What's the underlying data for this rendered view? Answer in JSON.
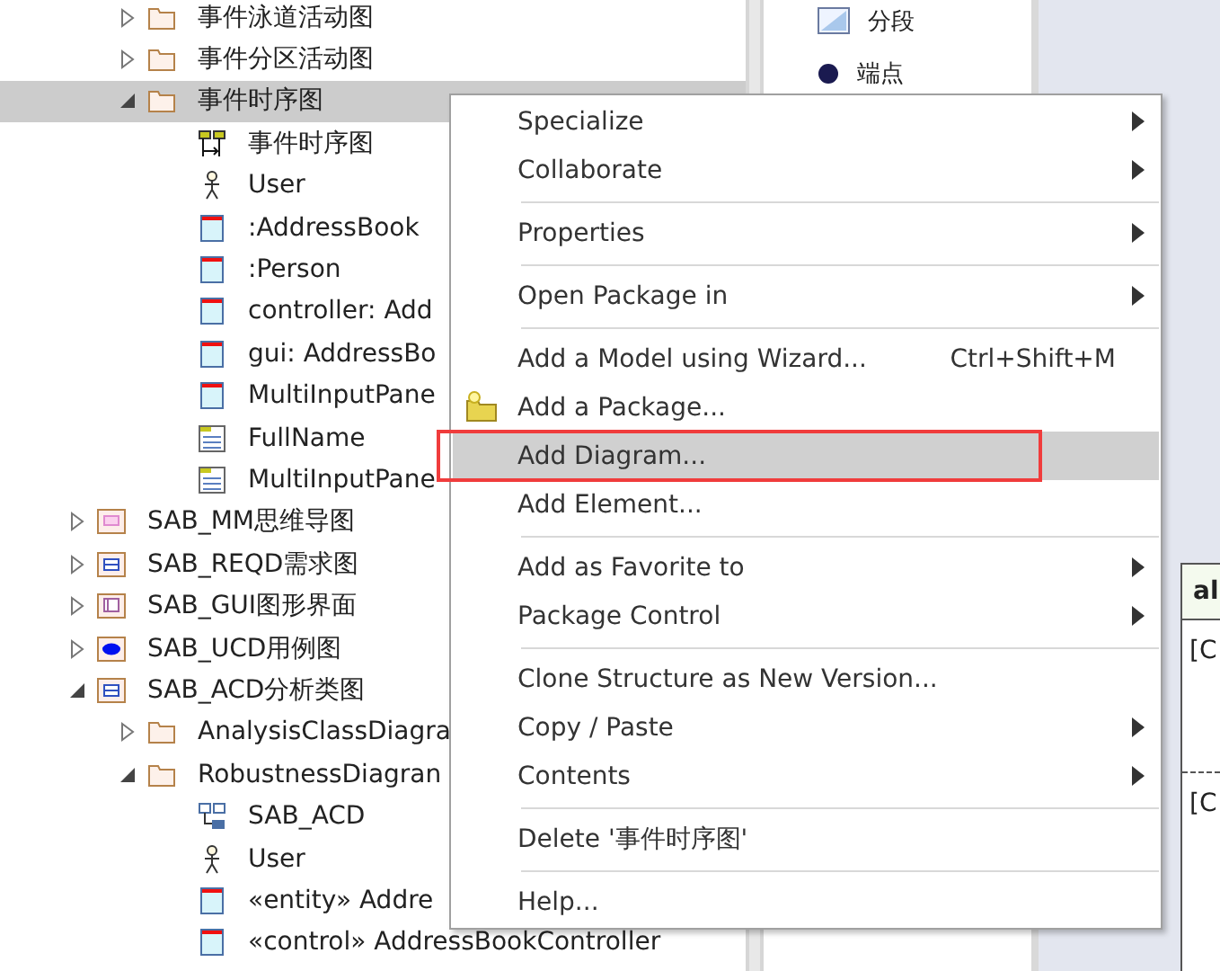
{
  "tree": {
    "continued_children": [
      {
        "label": "事件泳道活动图",
        "kind": "folder",
        "expanded": false,
        "selected": false
      },
      {
        "label": "事件分区活动图",
        "kind": "folder",
        "expanded": false,
        "selected": false
      },
      {
        "label": "事件时序图",
        "kind": "folder",
        "expanded": true,
        "selected": true,
        "children": [
          {
            "label": "事件时序图",
            "kind": "sequence"
          },
          {
            "label": "User",
            "kind": "actor"
          },
          {
            "label": ":AddressBook",
            "kind": "lifeline"
          },
          {
            "label": ":Person",
            "kind": "lifeline"
          },
          {
            "label": "controller: Add",
            "kind": "lifeline"
          },
          {
            "label": "gui: AddressBo",
            "kind": "lifeline"
          },
          {
            "label": "MultiInputPane",
            "kind": "lifeline"
          },
          {
            "label": "FullName",
            "kind": "attribute"
          },
          {
            "label": "MultiInputPane",
            "kind": "attribute"
          }
        ]
      }
    ],
    "items": [
      {
        "label": "SAB_MM思维导图",
        "kind": "mindmap",
        "expanded": false
      },
      {
        "label": "SAB_REQD需求图",
        "kind": "requirement",
        "expanded": false
      },
      {
        "label": "SAB_GUI图形界面",
        "kind": "gui",
        "expanded": false
      },
      {
        "label": "SAB_UCD用例图",
        "kind": "usecase",
        "expanded": false
      },
      {
        "label": "SAB_ACD分析类图",
        "kind": "requirement",
        "expanded": true,
        "children": [
          {
            "label": "AnalysisClassDiagra",
            "kind": "folder",
            "expanded": false
          },
          {
            "label": "RobustnessDiagran",
            "kind": "folder",
            "expanded": true,
            "children": [
              {
                "label": "SAB_ACD",
                "kind": "robustness"
              },
              {
                "label": "User",
                "kind": "actor"
              },
              {
                "label": "«entity» Addre",
                "kind": "lifeline"
              },
              {
                "label": "«control» AddressBookController",
                "kind": "lifeline"
              }
            ]
          }
        ]
      }
    ]
  },
  "toolbox": [
    {
      "label": "分段",
      "kind": "segment"
    },
    {
      "label": "端点",
      "kind": "endpoint"
    }
  ],
  "diagram_fragment": {
    "header": "al",
    "lines": [
      "[C",
      "[C"
    ]
  },
  "context_menu": [
    {
      "kind": "item",
      "label": "Specialize",
      "submenu": true,
      "selected": false
    },
    {
      "kind": "item",
      "label": "Collaborate",
      "submenu": true,
      "selected": false
    },
    {
      "kind": "separator"
    },
    {
      "kind": "item",
      "label": "Properties",
      "submenu": true,
      "selected": false
    },
    {
      "kind": "separator"
    },
    {
      "kind": "item",
      "label": "Open Package in",
      "submenu": true,
      "selected": false
    },
    {
      "kind": "separator"
    },
    {
      "kind": "item",
      "label": "Add a Model using Wizard...",
      "shortcut": "Ctrl+Shift+M",
      "submenu": false,
      "selected": false
    },
    {
      "kind": "package_item",
      "label": "Add a Package...",
      "submenu": false,
      "selected": false
    },
    {
      "kind": "item",
      "label": "Add Diagram...",
      "submenu": false,
      "selected": true
    },
    {
      "kind": "item",
      "label": "Add Element...",
      "submenu": false,
      "selected": false
    },
    {
      "kind": "separator"
    },
    {
      "kind": "item",
      "label": "Add as Favorite to",
      "submenu": true,
      "selected": false
    },
    {
      "kind": "item",
      "label": "Package Control",
      "submenu": true,
      "selected": false
    },
    {
      "kind": "separator"
    },
    {
      "kind": "item",
      "label": "Clone Structure as New Version...",
      "submenu": false,
      "selected": false
    },
    {
      "kind": "item",
      "label": "Copy / Paste",
      "submenu": true,
      "selected": false
    },
    {
      "kind": "item",
      "label": "Contents",
      "submenu": true,
      "selected": false
    },
    {
      "kind": "separator"
    },
    {
      "kind": "item",
      "label": "Delete '事件时序图'",
      "submenu": false,
      "selected": false
    },
    {
      "kind": "separator"
    },
    {
      "kind": "item",
      "label": "Help...",
      "submenu": false,
      "selected": false
    }
  ]
}
